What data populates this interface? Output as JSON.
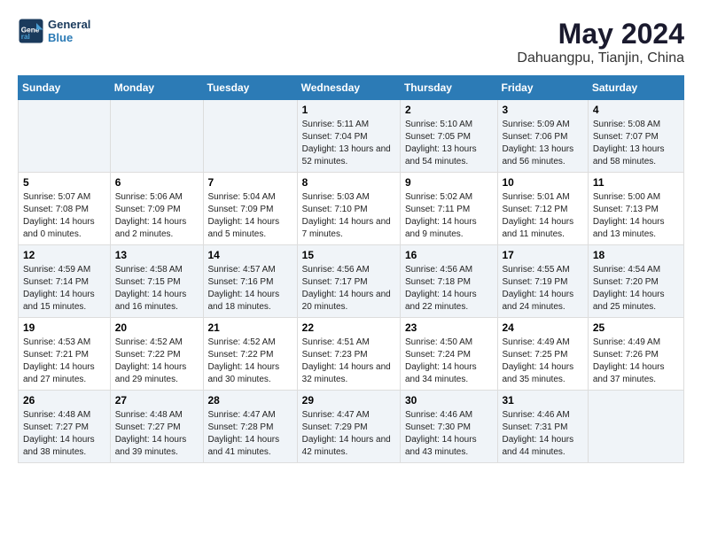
{
  "logo": {
    "text_general": "General",
    "text_blue": "Blue"
  },
  "title": "May 2024",
  "location": "Dahuangpu, Tianjin, China",
  "days_of_week": [
    "Sunday",
    "Monday",
    "Tuesday",
    "Wednesday",
    "Thursday",
    "Friday",
    "Saturday"
  ],
  "weeks": [
    [
      {
        "day": "",
        "content": ""
      },
      {
        "day": "",
        "content": ""
      },
      {
        "day": "",
        "content": ""
      },
      {
        "day": "1",
        "content": "Sunrise: 5:11 AM\nSunset: 7:04 PM\nDaylight: 13 hours and 52 minutes."
      },
      {
        "day": "2",
        "content": "Sunrise: 5:10 AM\nSunset: 7:05 PM\nDaylight: 13 hours and 54 minutes."
      },
      {
        "day": "3",
        "content": "Sunrise: 5:09 AM\nSunset: 7:06 PM\nDaylight: 13 hours and 56 minutes."
      },
      {
        "day": "4",
        "content": "Sunrise: 5:08 AM\nSunset: 7:07 PM\nDaylight: 13 hours and 58 minutes."
      }
    ],
    [
      {
        "day": "5",
        "content": "Sunrise: 5:07 AM\nSunset: 7:08 PM\nDaylight: 14 hours and 0 minutes."
      },
      {
        "day": "6",
        "content": "Sunrise: 5:06 AM\nSunset: 7:09 PM\nDaylight: 14 hours and 2 minutes."
      },
      {
        "day": "7",
        "content": "Sunrise: 5:04 AM\nSunset: 7:09 PM\nDaylight: 14 hours and 5 minutes."
      },
      {
        "day": "8",
        "content": "Sunrise: 5:03 AM\nSunset: 7:10 PM\nDaylight: 14 hours and 7 minutes."
      },
      {
        "day": "9",
        "content": "Sunrise: 5:02 AM\nSunset: 7:11 PM\nDaylight: 14 hours and 9 minutes."
      },
      {
        "day": "10",
        "content": "Sunrise: 5:01 AM\nSunset: 7:12 PM\nDaylight: 14 hours and 11 minutes."
      },
      {
        "day": "11",
        "content": "Sunrise: 5:00 AM\nSunset: 7:13 PM\nDaylight: 14 hours and 13 minutes."
      }
    ],
    [
      {
        "day": "12",
        "content": "Sunrise: 4:59 AM\nSunset: 7:14 PM\nDaylight: 14 hours and 15 minutes."
      },
      {
        "day": "13",
        "content": "Sunrise: 4:58 AM\nSunset: 7:15 PM\nDaylight: 14 hours and 16 minutes."
      },
      {
        "day": "14",
        "content": "Sunrise: 4:57 AM\nSunset: 7:16 PM\nDaylight: 14 hours and 18 minutes."
      },
      {
        "day": "15",
        "content": "Sunrise: 4:56 AM\nSunset: 7:17 PM\nDaylight: 14 hours and 20 minutes."
      },
      {
        "day": "16",
        "content": "Sunrise: 4:56 AM\nSunset: 7:18 PM\nDaylight: 14 hours and 22 minutes."
      },
      {
        "day": "17",
        "content": "Sunrise: 4:55 AM\nSunset: 7:19 PM\nDaylight: 14 hours and 24 minutes."
      },
      {
        "day": "18",
        "content": "Sunrise: 4:54 AM\nSunset: 7:20 PM\nDaylight: 14 hours and 25 minutes."
      }
    ],
    [
      {
        "day": "19",
        "content": "Sunrise: 4:53 AM\nSunset: 7:21 PM\nDaylight: 14 hours and 27 minutes."
      },
      {
        "day": "20",
        "content": "Sunrise: 4:52 AM\nSunset: 7:22 PM\nDaylight: 14 hours and 29 minutes."
      },
      {
        "day": "21",
        "content": "Sunrise: 4:52 AM\nSunset: 7:22 PM\nDaylight: 14 hours and 30 minutes."
      },
      {
        "day": "22",
        "content": "Sunrise: 4:51 AM\nSunset: 7:23 PM\nDaylight: 14 hours and 32 minutes."
      },
      {
        "day": "23",
        "content": "Sunrise: 4:50 AM\nSunset: 7:24 PM\nDaylight: 14 hours and 34 minutes."
      },
      {
        "day": "24",
        "content": "Sunrise: 4:49 AM\nSunset: 7:25 PM\nDaylight: 14 hours and 35 minutes."
      },
      {
        "day": "25",
        "content": "Sunrise: 4:49 AM\nSunset: 7:26 PM\nDaylight: 14 hours and 37 minutes."
      }
    ],
    [
      {
        "day": "26",
        "content": "Sunrise: 4:48 AM\nSunset: 7:27 PM\nDaylight: 14 hours and 38 minutes."
      },
      {
        "day": "27",
        "content": "Sunrise: 4:48 AM\nSunset: 7:27 PM\nDaylight: 14 hours and 39 minutes."
      },
      {
        "day": "28",
        "content": "Sunrise: 4:47 AM\nSunset: 7:28 PM\nDaylight: 14 hours and 41 minutes."
      },
      {
        "day": "29",
        "content": "Sunrise: 4:47 AM\nSunset: 7:29 PM\nDaylight: 14 hours and 42 minutes."
      },
      {
        "day": "30",
        "content": "Sunrise: 4:46 AM\nSunset: 7:30 PM\nDaylight: 14 hours and 43 minutes."
      },
      {
        "day": "31",
        "content": "Sunrise: 4:46 AM\nSunset: 7:31 PM\nDaylight: 14 hours and 44 minutes."
      },
      {
        "day": "",
        "content": ""
      }
    ]
  ]
}
